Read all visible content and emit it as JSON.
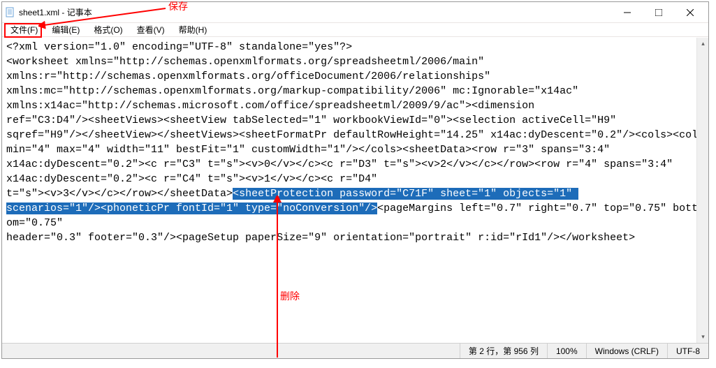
{
  "window": {
    "title": "sheet1.xml - 记事本"
  },
  "menu": {
    "file": "文件(F)",
    "edit": "编辑(E)",
    "format": "格式(O)",
    "view": "查看(V)",
    "help": "帮助(H)"
  },
  "annotations": {
    "save": "保存",
    "delete": "删除"
  },
  "content": {
    "line1": "<?xml version=\"1.0\" encoding=\"UTF-8\" standalone=\"yes\"?>",
    "line2": "<worksheet xmlns=\"http://schemas.openxmlformats.org/spreadsheetml/2006/main\" ",
    "line3": "xmlns:r=\"http://schemas.openxmlformats.org/officeDocument/2006/relationships\" ",
    "line4": "xmlns:mc=\"http://schemas.openxmlformats.org/markup-compatibility/2006\" mc:Ignorable=\"x14ac\" ",
    "line5": "xmlns:x14ac=\"http://schemas.microsoft.com/office/spreadsheetml/2009/9/ac\"><dimension ",
    "line6": "ref=\"C3:D4\"/><sheetViews><sheetView tabSelected=\"1\" workbookViewId=\"0\"><selection activeCell=\"H9\" ",
    "line7": "sqref=\"H9\"/></sheetView></sheetViews><sheetFormatPr defaultRowHeight=\"14.25\" x14ac:dyDescent=\"0.2\"/><cols><col ",
    "line8": "min=\"4\" max=\"4\" width=\"11\" bestFit=\"1\" customWidth=\"1\"/></cols><sheetData><row r=\"3\" spans=\"3:4\" ",
    "line9": "x14ac:dyDescent=\"0.2\"><c r=\"C3\" t=\"s\"><v>0</v></c><c r=\"D3\" t=\"s\"><v>2</v></c></row><row r=\"4\" spans=\"3:4\" ",
    "line10": "x14ac:dyDescent=\"0.2\"><c r=\"C4\" t=\"s\"><v>1</v></c><c r=\"D4\" ",
    "line11_before": "t=\"s\"><v>3</v></c></row></sheetData>",
    "line11_selected": "<sheetProtection password=\"C71F\" sheet=\"1\" objects=\"1\" ",
    "line12_selected": "scenarios=\"1\"/><phoneticPr fontId=\"1\" type=\"noConversion\"/>",
    "line12_after": "<pageMargins left=\"0.7\" right=\"0.7\" top=\"0.75\" bottom=\"0.75\" ",
    "line13": "header=\"0.3\" footer=\"0.3\"/><pageSetup paperSize=\"9\" orientation=\"portrait\" r:id=\"rId1\"/></worksheet>"
  },
  "statusbar": {
    "position": "第 2 行，第 956 列",
    "zoom": "100%",
    "eol": "Windows (CRLF)",
    "encoding": "UTF-8"
  }
}
